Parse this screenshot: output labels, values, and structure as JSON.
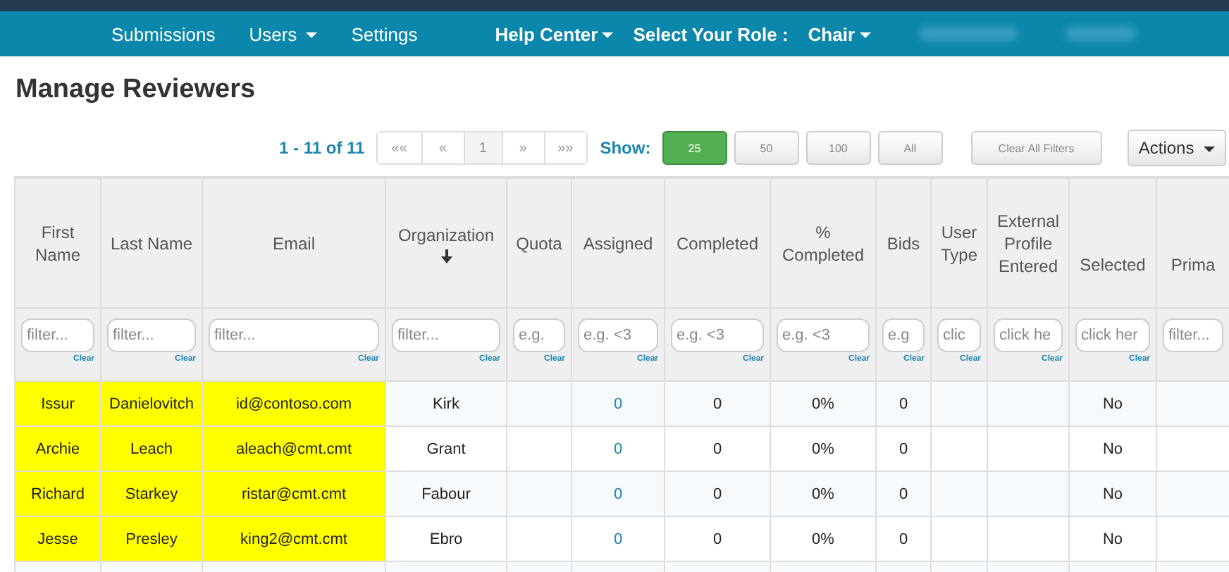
{
  "navbar": {
    "items": [
      {
        "label": "Submissions",
        "kind": "link"
      },
      {
        "label": "Users",
        "kind": "dropdown"
      },
      {
        "label": "Settings",
        "kind": "link"
      }
    ],
    "right_items": [
      {
        "label": "Help Center",
        "kind": "dropdown"
      },
      {
        "label": "Select Your Role :",
        "kind": "text"
      },
      {
        "label": "Chair",
        "kind": "dropdown"
      }
    ]
  },
  "page_title": "Manage Reviewers",
  "pager": {
    "range": "1 - 11 of 11",
    "buttons": [
      {
        "label": "««",
        "selected": false
      },
      {
        "label": "«",
        "selected": false
      },
      {
        "label": "1",
        "selected": true
      },
      {
        "label": "»",
        "selected": false
      },
      {
        "label": "»»",
        "selected": false
      }
    ]
  },
  "show": {
    "label": "Show:",
    "options": [
      {
        "label": "25",
        "selected": true
      },
      {
        "label": "50",
        "selected": false
      },
      {
        "label": "100",
        "selected": false
      },
      {
        "label": "All",
        "selected": false
      }
    ]
  },
  "clear_all_filters": "Clear All Filters",
  "actions": "Actions",
  "table": {
    "columns": [
      {
        "label": "First Name",
        "placeholder": "filter...",
        "clear": "Clear",
        "sorted": false
      },
      {
        "label": "Last Name",
        "placeholder": "filter...",
        "clear": "Clear",
        "sorted": false
      },
      {
        "label": "Email",
        "placeholder": "filter...",
        "clear": "Clear",
        "sorted": false
      },
      {
        "label": "Organization",
        "placeholder": "filter...",
        "clear": "Clear",
        "sorted": true
      },
      {
        "label": "Quota",
        "placeholder": "e.g.",
        "clear": "Clear",
        "sorted": false
      },
      {
        "label": "Assigned",
        "placeholder": "e.g. <3",
        "clear": "Clear",
        "sorted": false
      },
      {
        "label": "Completed",
        "placeholder": "e.g. <3",
        "clear": "Clear",
        "sorted": false
      },
      {
        "label": "% Completed",
        "placeholder": "e.g. <3",
        "clear": "Clear",
        "sorted": false
      },
      {
        "label": "Bids",
        "placeholder": "e.g",
        "clear": "Clear",
        "sorted": false
      },
      {
        "label": "User Type",
        "placeholder": "clic",
        "clear": "Clear",
        "sorted": false
      },
      {
        "label": "External Profile Entered",
        "placeholder": "click he",
        "clear": "Clear",
        "sorted": false
      },
      {
        "label": "Selected",
        "placeholder": "click her",
        "clear": "Clear",
        "sorted": false
      },
      {
        "label": "Prima",
        "placeholder": "filter...",
        "sorted": false
      }
    ],
    "rows": [
      {
        "highlighted": true,
        "cells": [
          "Issur",
          "Danielovitch",
          "id@contoso.com",
          "Kirk",
          "",
          "0",
          "0",
          "0%",
          "0",
          "",
          "",
          "No",
          ""
        ]
      },
      {
        "highlighted": true,
        "cells": [
          "Archie",
          "Leach",
          "aleach@cmt.cmt",
          "Grant",
          "",
          "0",
          "0",
          "0%",
          "0",
          "",
          "",
          "No",
          ""
        ]
      },
      {
        "highlighted": true,
        "cells": [
          "Richard",
          "Starkey",
          "ristar@cmt.cmt",
          "Fabour",
          "",
          "0",
          "0",
          "0%",
          "0",
          "",
          "",
          "No",
          ""
        ]
      },
      {
        "highlighted": true,
        "cells": [
          "Jesse",
          "Presley",
          "king2@cmt.cmt",
          "Ebro",
          "",
          "0",
          "0",
          "0%",
          "0",
          "",
          "",
          "No",
          ""
        ]
      }
    ]
  }
}
